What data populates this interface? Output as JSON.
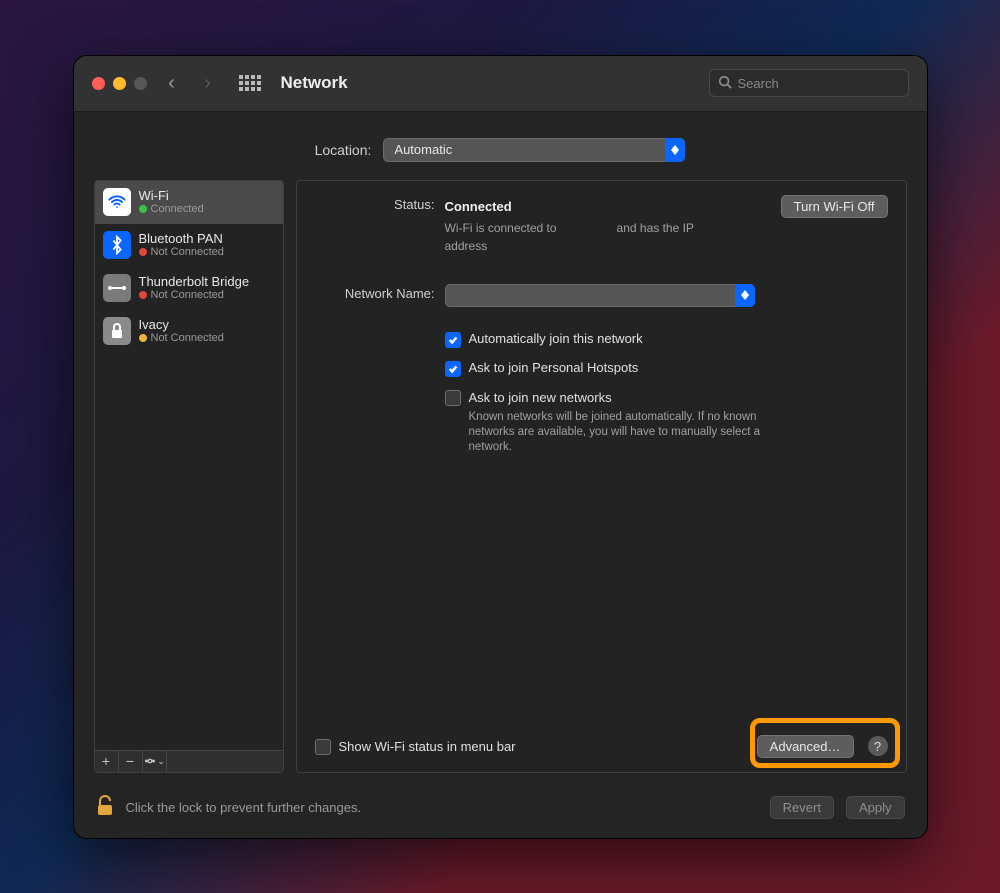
{
  "window": {
    "title": "Network",
    "search_placeholder": "Search"
  },
  "location": {
    "label": "Location:",
    "value": "Automatic"
  },
  "sidebar": {
    "services": [
      {
        "name": "Wi-Fi",
        "status": "Connected",
        "color": "green",
        "icon": "wifi",
        "selected": true
      },
      {
        "name": "Bluetooth PAN",
        "status": "Not Connected",
        "color": "red",
        "icon": "bluetooth",
        "selected": false
      },
      {
        "name": "Thunderbolt Bridge",
        "status": "Not Connected",
        "color": "red",
        "icon": "thunderbolt",
        "selected": false
      },
      {
        "name": "Ivacy",
        "status": "Not Connected",
        "color": "yellow",
        "icon": "lock",
        "selected": false
      }
    ]
  },
  "panel": {
    "status_label": "Status:",
    "status_value": "Connected",
    "status_desc_1": "Wi-Fi is connected to",
    "status_desc_2": "and has the IP",
    "status_desc_3": "address",
    "wifi_toggle": "Turn Wi-Fi Off",
    "network_name_label": "Network Name:",
    "network_name_value": "",
    "checks": {
      "auto_join": {
        "checked": true,
        "label": "Automatically join this network"
      },
      "hotspots": {
        "checked": true,
        "label": "Ask to join Personal Hotspots"
      },
      "new_nets": {
        "checked": false,
        "label": "Ask to join new networks",
        "note": "Known networks will be joined automatically. If no known networks are available, you will have to manually select a network."
      }
    },
    "menubar_check": {
      "checked": false,
      "label": "Show Wi-Fi status in menu bar"
    },
    "advanced": "Advanced…"
  },
  "footer": {
    "lock_text": "Click the lock to prevent further changes.",
    "revert": "Revert",
    "apply": "Apply"
  }
}
